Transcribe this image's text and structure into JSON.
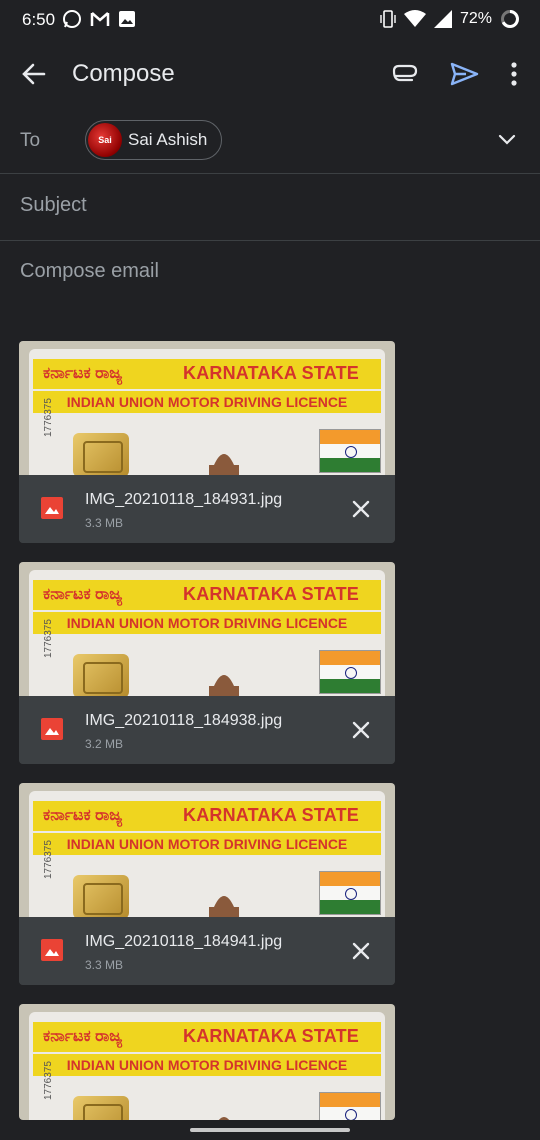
{
  "status_bar": {
    "time": "6:50",
    "battery": "72%",
    "left_icons": [
      "whatsapp-icon",
      "gmail-icon",
      "image-icon"
    ],
    "right_icons": [
      "vibrate-icon",
      "wifi-icon",
      "signal-icon",
      "battery-ring-icon"
    ]
  },
  "toolbar": {
    "title": "Compose",
    "send_color": "#8ab4f8"
  },
  "to": {
    "label": "To",
    "recipient": "Sai Ashish",
    "avatar_text": "Sai"
  },
  "subject": {
    "placeholder": "Subject"
  },
  "body": {
    "placeholder": "Compose email"
  },
  "attachments": [
    {
      "filename": "IMG_20210118_184931.jpg",
      "size": "3.3 MB"
    },
    {
      "filename": "IMG_20210118_184938.jpg",
      "size": "3.2 MB"
    },
    {
      "filename": "IMG_20210118_184941.jpg",
      "size": "3.3 MB"
    },
    {
      "filename": "",
      "size": ""
    }
  ],
  "thumb": {
    "kannada": "ಕರ್ನಾಟಕ ರಾಜ್ಯ",
    "state": "KARNATAKA STATE",
    "licence": "INDIAN UNION MOTOR DRIVING LICENCE",
    "serial": "1776375"
  }
}
